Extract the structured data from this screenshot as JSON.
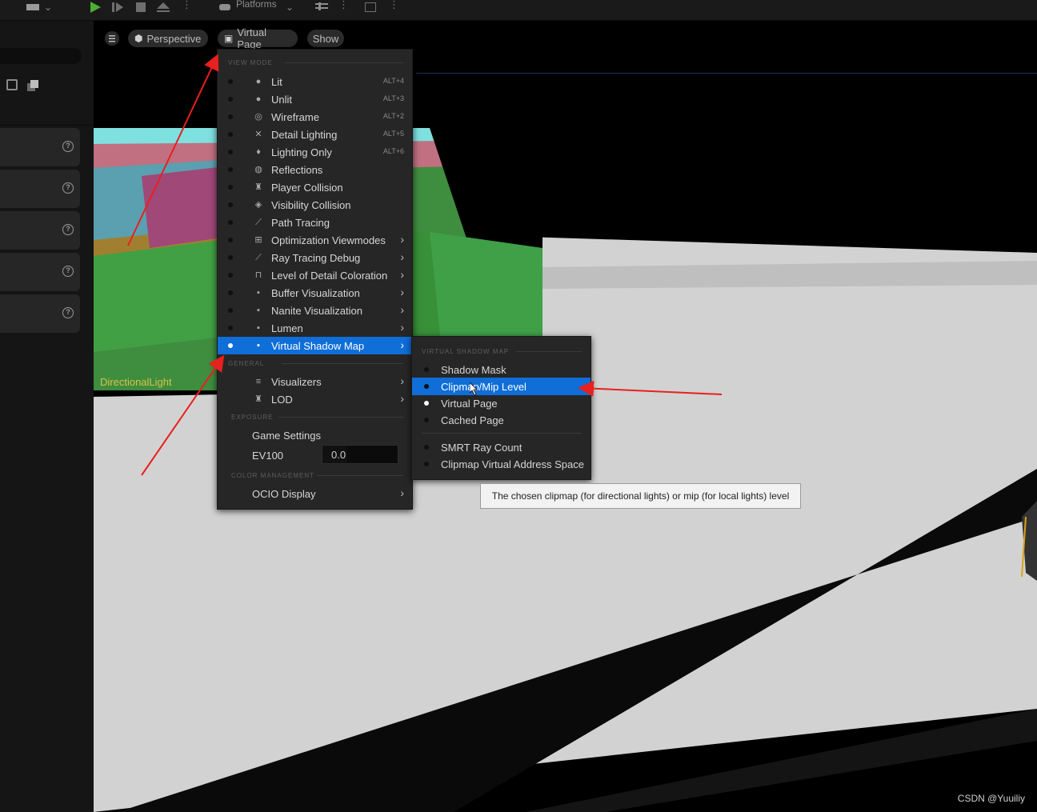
{
  "toolbar": {
    "platforms_label": "Platforms"
  },
  "viewport": {
    "perspective_label": "Perspective",
    "view_mode_label": "Virtual Page",
    "show_label": "Show",
    "light_label": "DirectionalLight"
  },
  "view_mode_menu": {
    "view_mode_header": "VIEW MODE",
    "items": [
      {
        "label": "Lit",
        "shortcut": "ALT+4"
      },
      {
        "label": "Unlit",
        "shortcut": "ALT+3"
      },
      {
        "label": "Wireframe",
        "shortcut": "ALT+2"
      },
      {
        "label": "Detail Lighting",
        "shortcut": "ALT+5"
      },
      {
        "label": "Lighting Only",
        "shortcut": "ALT+6"
      },
      {
        "label": "Reflections"
      },
      {
        "label": "Player Collision"
      },
      {
        "label": "Visibility Collision"
      },
      {
        "label": "Path Tracing"
      },
      {
        "label": "Optimization Viewmodes"
      },
      {
        "label": "Ray Tracing Debug"
      },
      {
        "label": "Level of Detail Coloration"
      },
      {
        "label": "Buffer Visualization"
      },
      {
        "label": "Nanite Visualization"
      },
      {
        "label": "Lumen"
      },
      {
        "label": "Virtual Shadow Map"
      }
    ],
    "general_header": "GENERAL",
    "visualizers_label": "Visualizers",
    "lod_label": "LOD",
    "exposure_header": "EXPOSURE",
    "game_settings_label": "Game Settings",
    "ev100_label": "EV100",
    "ev100_value": "0.0",
    "color_management_header": "COLOR MANAGEMENT",
    "ocio_label": "OCIO Display"
  },
  "vsm_submenu": {
    "header": "VIRTUAL SHADOW MAP",
    "items": [
      {
        "label": "Shadow Mask"
      },
      {
        "label": "Clipmap/Mip Level"
      },
      {
        "label": "Virtual Page"
      },
      {
        "label": "Cached Page"
      },
      {
        "label": "SMRT Ray Count"
      },
      {
        "label": "Clipmap Virtual Address Space"
      }
    ]
  },
  "tooltip": {
    "text": "The chosen clipmap (for directional lights) or mip (for local lights) level"
  },
  "watermark": "CSDN @Yuuiliy",
  "colors": {
    "highlight": "#0f6ed8",
    "menu_bg": "#262626",
    "annotation_arrow": "#e8201e",
    "light_label": "#d9c24a"
  }
}
